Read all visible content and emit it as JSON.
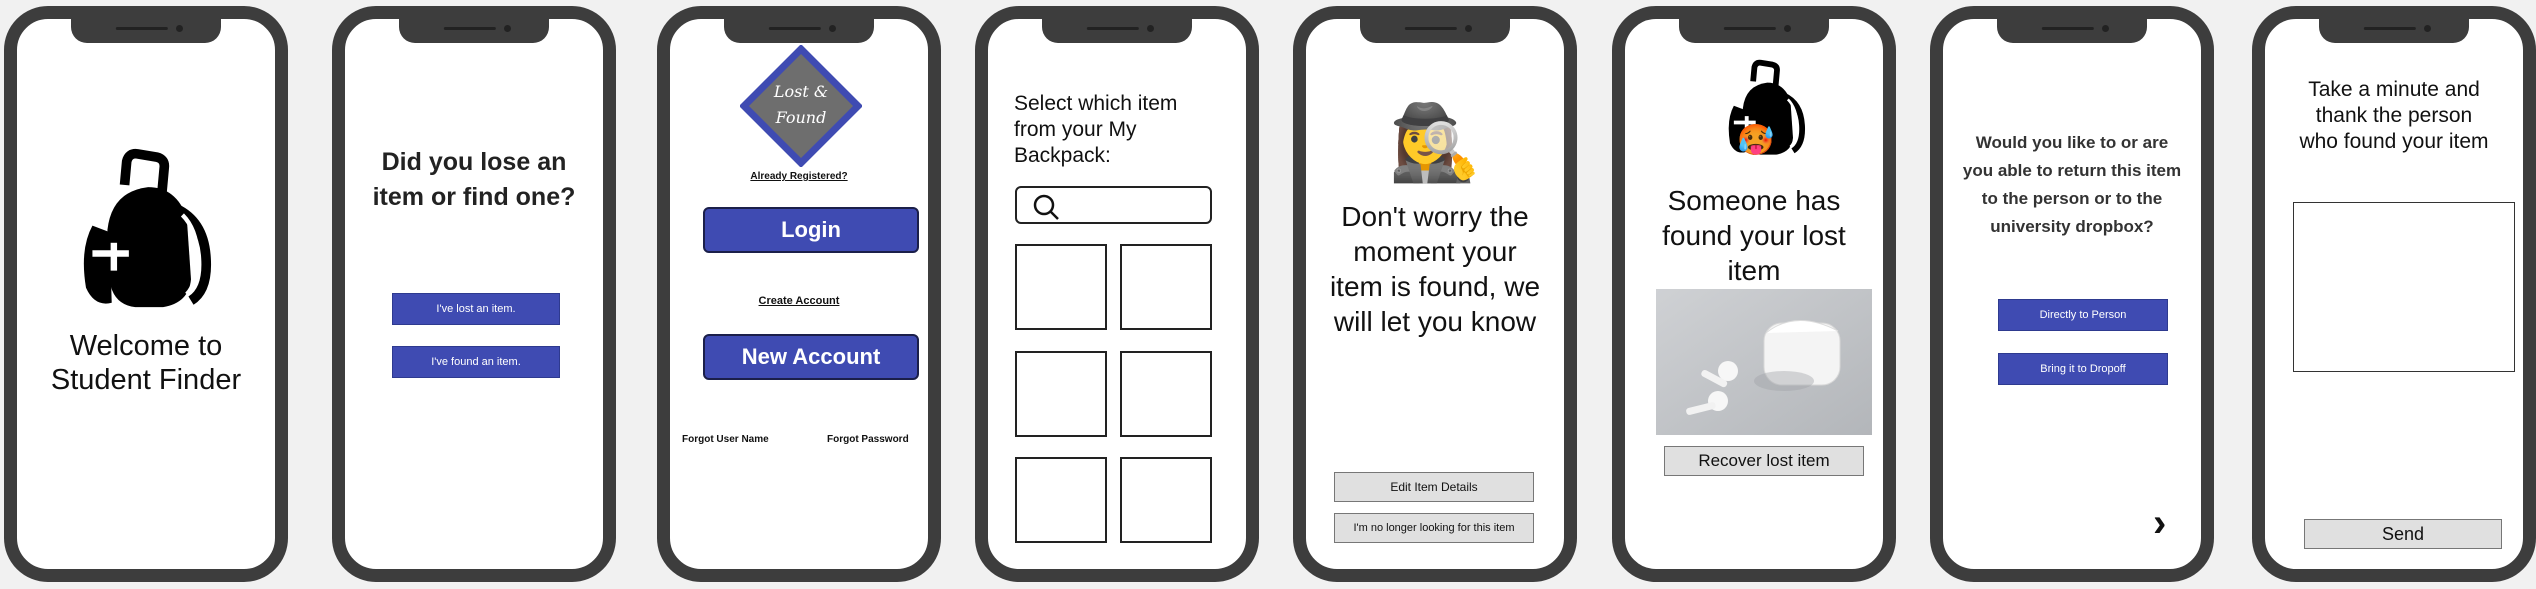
{
  "screens": {
    "welcome": {
      "title": "Welcome to Student Finder",
      "icon": "backpack-icon"
    },
    "lose_or_find": {
      "question": "Did you lose an item or find one?",
      "lost_button": "I've lost an item.",
      "found_button": "I've found an item."
    },
    "login": {
      "logo_text": "Lost & Found",
      "already_registered": "Already Registered?",
      "login_button": "Login",
      "create_account": "Create Account",
      "new_account_button": "New Account",
      "forgot_user": "Forgot User Name",
      "forgot_password": "Forgot Password"
    },
    "select_item": {
      "prompt": "Select which item from your My Backpack:",
      "search_icon": "search-icon",
      "slots": 6
    },
    "dont_worry": {
      "icon": "detective-emoji",
      "emoji": "🕵️‍♀️",
      "message": "Don't worry the moment your item is found, we will let you know",
      "edit_button": "Edit Item Details",
      "stop_button": "I'm no longer looking for this item"
    },
    "found": {
      "emoji": "🥵",
      "message": "Someone has found your lost item",
      "recover_button": "Recover lost item"
    },
    "return_choice": {
      "question": "Would you like to or are you able to return this item to the person or to the university dropbox?",
      "direct_button": "Directly to Person",
      "dropoff_button": "Bring it to Dropoff",
      "next_icon": "chevron-right-icon",
      "next_glyph": "›"
    },
    "thank": {
      "prompt": "Take a minute and thank the person who found your item",
      "send_button": "Send"
    }
  },
  "colors": {
    "accent": "#3f4bb2",
    "frame": "#3d3d3d",
    "logo_fill": "#6e6e6e",
    "gray_button": "#e0e0e0"
  }
}
